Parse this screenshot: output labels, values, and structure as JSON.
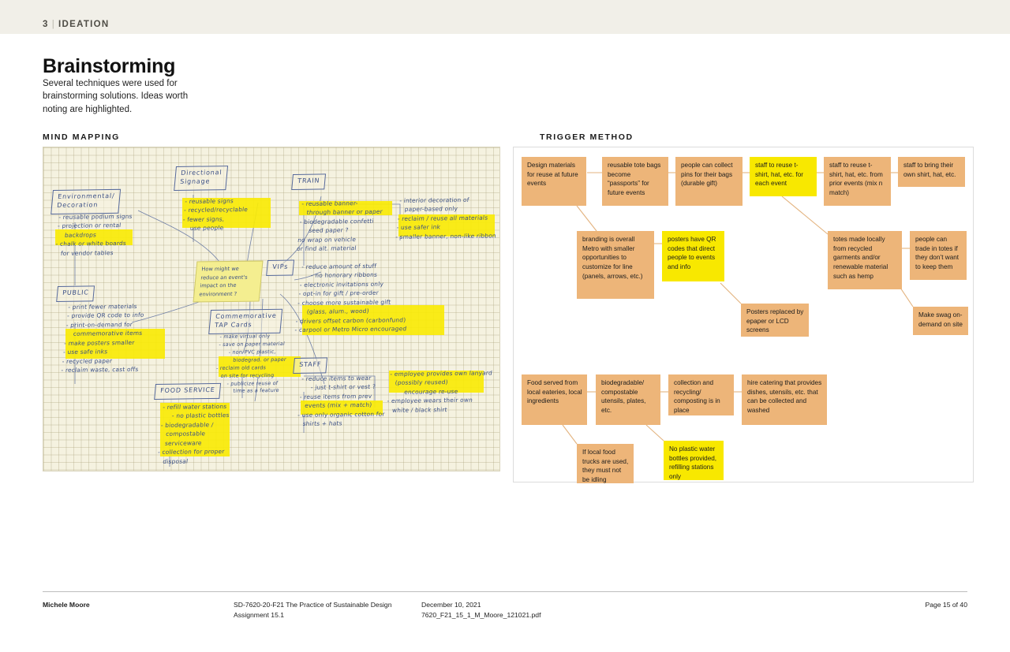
{
  "header": {
    "chapter_number": "3",
    "separator": "|",
    "chapter_title": "IDEATION"
  },
  "title": "Brainstorming",
  "intro": "Several techniques were used for brainstorming solutions. Ideas worth noting are highlighted.",
  "sections": {
    "mind_mapping_label": "MIND MAPPING",
    "trigger_method_label": "TRIGGER METHOD"
  },
  "mind_map": {
    "center_question": "How might we\nreduce an event's\nimpact on the\nenvironment ?",
    "branches": [
      {
        "node": "Environmental/\nDecoration",
        "items": [
          "- reusable podium signs",
          "- projection or rental",
          "   backdrops",
          "- chalk or white boards",
          "   for vendor tables"
        ],
        "highlighted": [
          "- projection or rental",
          "   backdrops"
        ]
      },
      {
        "node": "Directional\nSignage",
        "items": [
          "- reusable signs",
          "- recycled/recyclable",
          "- fewer signs,",
          "   use people"
        ],
        "highlighted": [
          "- reusable signs",
          "- recycled/recyclable",
          "- fewer signs,",
          "   use people"
        ]
      },
      {
        "node": "TRAIN",
        "items": [
          "- reusable banner-",
          "   through banner or paper",
          "- biodegradable confetti",
          "    seed paper ?",
          "no wrap on vehicle",
          "or find alt. material"
        ],
        "highlighted": [
          "- reusable banner-",
          "   through banner or paper"
        ]
      },
      {
        "node": "TRAIN-right",
        "items": [
          "- interior decoration of",
          "   paper-based only",
          "- reclaim / reuse all materials",
          "- use safer ink",
          "- smaller banner, non-like ribbon"
        ],
        "highlighted": [
          "- reclaim / reuse all materials",
          "- use safer ink",
          "- smaller banner, non-like ribbon"
        ]
      },
      {
        "node": "VIPs",
        "items": [
          "- reduce amount of stuff",
          "    - no honorary ribbons",
          "- electronic invitations only",
          "- opt-in for gift / pre-order",
          "- choose more sustainable gift",
          "    (glass, alum., wood)",
          "- drivers offset carbon (carbonfund)",
          "- carpool or Metro Micro encouraged"
        ],
        "highlighted": [
          "- choose more sustainable gift",
          "    (glass, alum., wood)",
          "- drivers offset carbon (carbonfund)",
          "- carpool or Metro Micro encouraged"
        ]
      },
      {
        "node": "PUBLIC",
        "items": [
          "- print fewer materials",
          "- provide QR code to info",
          "- print-on-demand for",
          "   commemorative items",
          "- make posters smaller",
          "- use safe inks",
          "- recycled paper",
          "- reclaim waste, cast offs"
        ],
        "highlighted": [
          "- make posters smaller",
          "- use safe inks",
          "- recycled paper",
          "- reclaim waste, cast offs"
        ]
      },
      {
        "node": "Commemorative\nTAP Cards",
        "items": [
          "- make virtual only",
          "- save on paper material",
          "     - non-PVC plastic,",
          "        biodegrad. or paper",
          "- reclaim old cards",
          "   on site for recycling",
          "      - publicize reuse of",
          "         time as a feature"
        ],
        "highlighted": [
          "- reclaim old cards",
          "   on site for recycling",
          "      - publicize reuse of",
          "         time as a feature"
        ]
      },
      {
        "node": "FOOD SERVICE",
        "items": [
          "- refill water stations",
          "    - no plastic bottles",
          "- biodegradable /",
          "   compostable",
          "   serviceware",
          "- collection for proper",
          "   disposal"
        ],
        "highlighted": [
          "- refill water stations",
          "    - no plastic bottles",
          "- biodegradable /",
          "   compostable",
          "   serviceware",
          "- collection for proper",
          "   disposal"
        ]
      },
      {
        "node": "STAFF",
        "items": [
          "- reduce items to wear",
          "    - just t-shirt or vest ?",
          "- reuse items from prev",
          "   events (mix + match)",
          "- use only organic cotton for",
          "   shirts + hats"
        ],
        "highlighted": [
          "- use only organic cotton for",
          "   shirts + hats"
        ]
      },
      {
        "node": "STAFF-right",
        "items": [
          "- employee provides own lanyard",
          "   (possibly reused)",
          "        encourage re-use",
          "- employee wears their own",
          "   white / black shirt"
        ],
        "highlighted": [
          "- employee provides own lanyard",
          "   (possibly reused)",
          "        encourage re-use"
        ]
      }
    ]
  },
  "trigger_method": {
    "colors": {
      "note": "#edb579",
      "highlight": "#f8e800"
    },
    "notes": [
      {
        "id": "n1",
        "text": "Design materials for reuse at future events",
        "highlighted": false
      },
      {
        "id": "n2",
        "text": "reusable tote bags become “passports” for future events",
        "highlighted": false
      },
      {
        "id": "n3",
        "text": "people can collect pins for their bags (durable gift)",
        "highlighted": false
      },
      {
        "id": "n4",
        "text": "staff to reuse t-shirt, hat, etc. for each event",
        "highlighted": true
      },
      {
        "id": "n5",
        "text": "staff to reuse t-shirt, hat, etc. from prior events (mix n match)",
        "highlighted": false
      },
      {
        "id": "n6",
        "text": "staff to bring their own shirt, hat, etc.",
        "highlighted": false
      },
      {
        "id": "n7",
        "text": "branding is overall Metro with smaller opportunities to customize for line (panels, arrows, etc.)",
        "highlighted": false
      },
      {
        "id": "n8",
        "text": "posters have QR codes that direct people to events and info",
        "highlighted": true
      },
      {
        "id": "n9",
        "text": "Posters replaced by epaper or LCD screens",
        "highlighted": false
      },
      {
        "id": "n10",
        "text": "totes made locally from recycled garments and/or renewable material such as hemp",
        "highlighted": false
      },
      {
        "id": "n11",
        "text": "people can trade in totes if they don’t want to keep them",
        "highlighted": false
      },
      {
        "id": "n12",
        "text": "Make swag on-demand on site",
        "highlighted": false
      },
      {
        "id": "n13",
        "text": "Food served from local eateries, local ingredients",
        "highlighted": false
      },
      {
        "id": "n14",
        "text": "biodegradable/ compostable utensils, plates, etc.",
        "highlighted": false
      },
      {
        "id": "n15",
        "text": "collection and recycling/ composting is in place",
        "highlighted": false
      },
      {
        "id": "n16",
        "text": "hire catering that provides dishes, utensils, etc. that can be collected and washed",
        "highlighted": false
      },
      {
        "id": "n17",
        "text": "If local food trucks are used, they must not be idling",
        "highlighted": false
      },
      {
        "id": "n18",
        "text": "No plastic water bottles provided, refilling stations only",
        "highlighted": true
      }
    ]
  },
  "footer": {
    "author": "Michele Moore",
    "course_line1": "SD-7620-20-F21 The Practice of Sustainable Design",
    "course_line2": "Assignment 15.1",
    "date_line1": "December 10, 2021",
    "date_line2": "7620_F21_15_1_M_Moore_121021.pdf",
    "page": "Page 15 of 40"
  }
}
